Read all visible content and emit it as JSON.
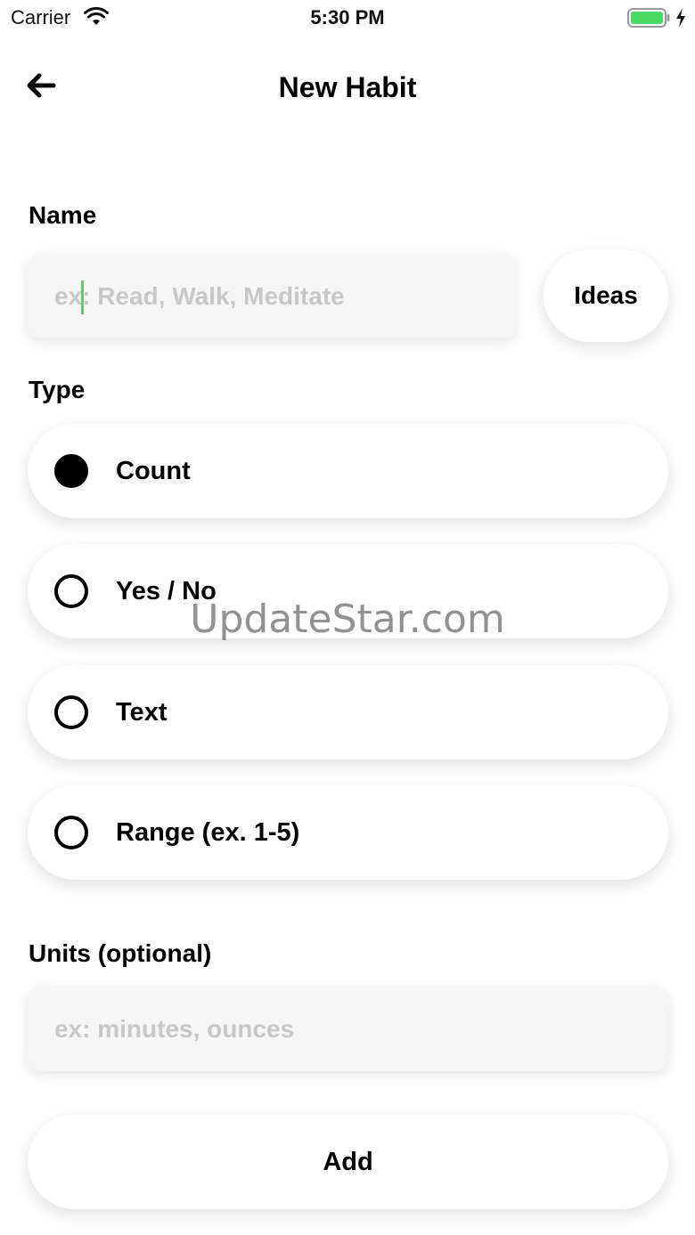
{
  "status_bar": {
    "carrier": "Carrier",
    "time": "5:30 PM",
    "wifi_icon": "wifi-icon",
    "battery_icon": "battery-icon",
    "charging_icon": "charging-bolt-icon",
    "battery_color": "#4cd964"
  },
  "nav": {
    "back_icon": "arrow-left-icon",
    "title": "New Habit"
  },
  "name_section": {
    "label": "Name",
    "input_value": "",
    "placeholder": "ex: Read, Walk, Meditate",
    "ideas_label": "Ideas"
  },
  "type_section": {
    "label": "Type",
    "options": [
      {
        "label": "Count",
        "selected": true
      },
      {
        "label": "Yes / No",
        "selected": false
      },
      {
        "label": "Text",
        "selected": false
      },
      {
        "label": "Range (ex. 1-5)",
        "selected": false
      }
    ]
  },
  "units_section": {
    "label": "Units (optional)",
    "input_value": "",
    "placeholder": "ex: minutes, ounces"
  },
  "add_label": "Add",
  "watermark": "UpdateStar.com"
}
